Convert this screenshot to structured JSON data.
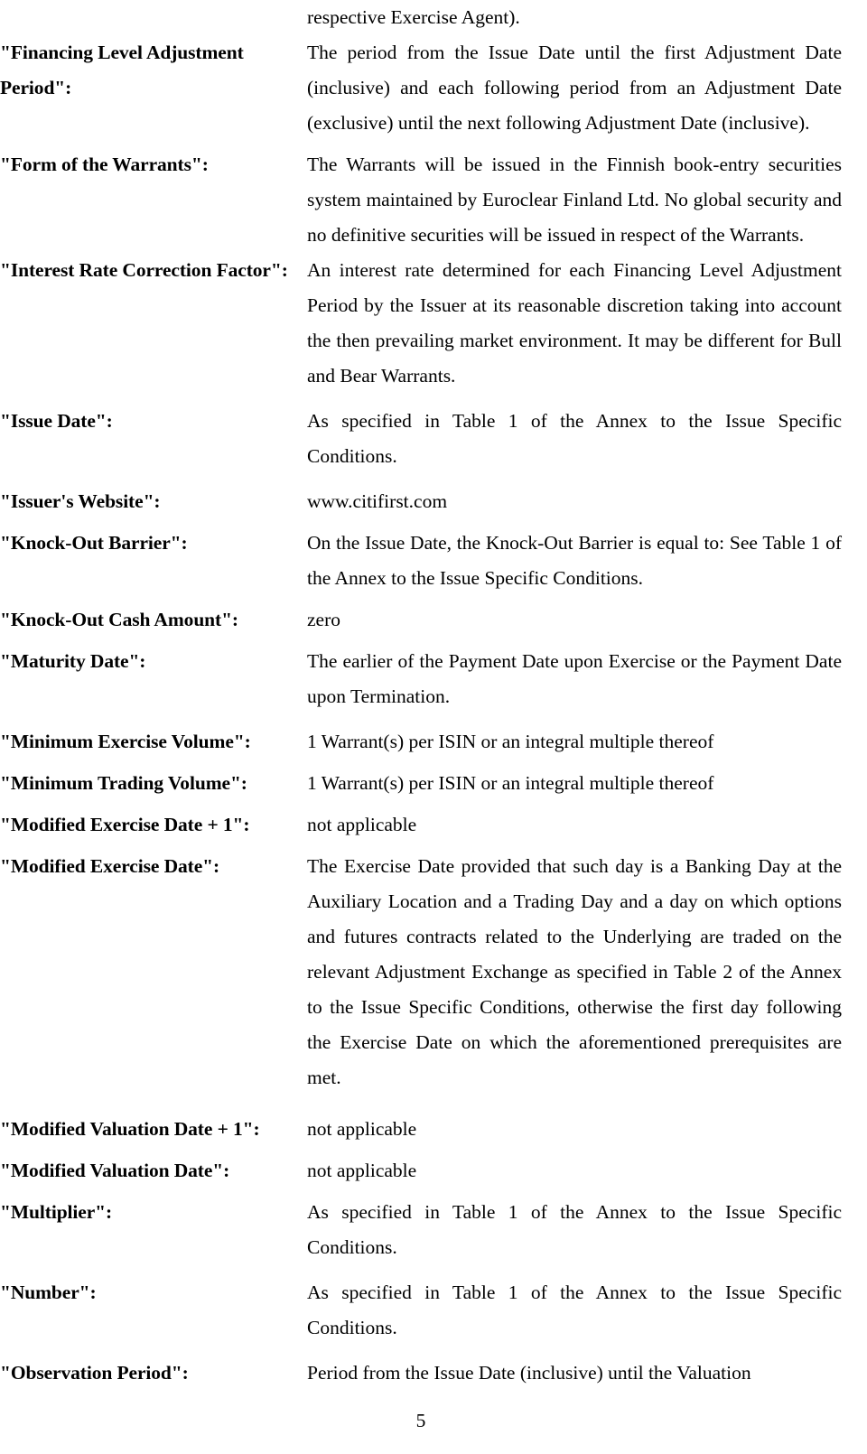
{
  "document": {
    "page_number": "5",
    "continuation_text": "respective Exercise Agent).",
    "entries": [
      {
        "term": "\"Financing Level Adjustment Period\":",
        "definition": "The period from the Issue Date until the first Adjustment Date (inclusive) and each following period from an Adjustment Date (exclusive) until the next following Adjustment Date (inclusive)."
      },
      {
        "term": "\"Form of the Warrants\":",
        "definition": "The Warrants will be issued in the Finnish book-entry securities system maintained by Euroclear Finland Ltd. No global security and no definitive securities will be issued in respect of the Warrants."
      },
      {
        "term": "\"Interest Rate Correction Factor\":",
        "definition": "An interest rate determined for each Financing Level Adjustment Period by the Issuer at its reasonable discretion taking into account the then prevailing market environment. It may be different for Bull and Bear Warrants."
      },
      {
        "term": "\"Issue Date\":",
        "definition": "As specified in Table 1 of the Annex to the Issue Specific Conditions."
      },
      {
        "term": "\"Issuer's Website\":",
        "definition": "www.citifirst.com"
      },
      {
        "term": "\"Knock-Out Barrier\":",
        "definition": "On the Issue Date, the Knock-Out Barrier is equal to: See Table 1 of the Annex to the Issue Specific Conditions."
      },
      {
        "term": "\"Knock-Out Cash Amount\":",
        "definition": "zero"
      },
      {
        "term": "\"Maturity Date\":",
        "definition": "The earlier of the Payment Date upon Exercise or the Payment Date upon Termination."
      },
      {
        "term": "\"Minimum Exercise Volume\":",
        "definition": "1 Warrant(s) per ISIN or an integral multiple thereof"
      },
      {
        "term": "\"Minimum Trading Volume\":",
        "definition": "1 Warrant(s) per ISIN or an integral multiple thereof"
      },
      {
        "term": "\"Modified Exercise Date + 1\":",
        "definition": "not applicable"
      },
      {
        "term": "\"Modified Exercise Date\":",
        "definition": "The Exercise Date provided that such day is a Banking Day at the Auxiliary Location and a Trading Day and a day on which options and futures contracts related to the Underlying are traded on the relevant Adjustment Exchange as specified in Table 2 of the Annex to the Issue Specific Conditions, otherwise the first day following the Exercise Date on which the aforementioned prerequisites are met."
      },
      {
        "term": "\"Modified Valuation Date + 1\":",
        "definition": "not applicable"
      },
      {
        "term": "\"Modified Valuation Date\":",
        "definition": "not applicable"
      },
      {
        "term": "\"Multiplier\":",
        "definition": "As specified in Table 1 of the Annex to the Issue Specific Conditions."
      },
      {
        "term": "\"Number\":",
        "definition": "As specified in Table 1 of the Annex to the Issue Specific Conditions."
      },
      {
        "term": "\"Observation Period\":",
        "definition": "Period from the Issue Date (inclusive) until the Valuation"
      }
    ]
  }
}
